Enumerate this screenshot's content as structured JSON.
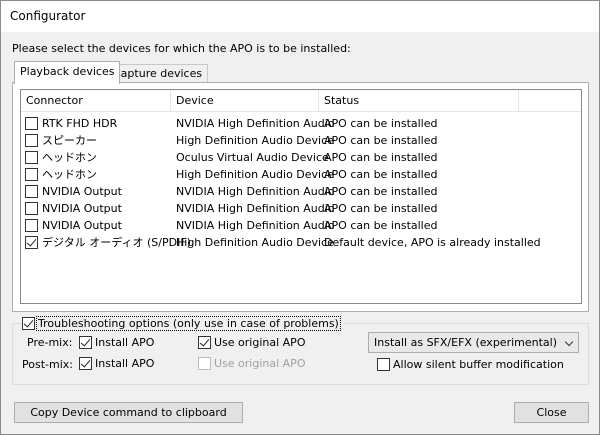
{
  "window": {
    "title": "Configurator"
  },
  "prompt": "Please select the devices for which the APO is to be installed:",
  "tabs": [
    {
      "label": "Playback devices",
      "active": true
    },
    {
      "label": "Capture devices",
      "active": false
    }
  ],
  "list": {
    "columns": [
      "Connector",
      "Device",
      "Status"
    ],
    "rows": [
      {
        "checked": false,
        "connector": "RTK FHD HDR",
        "device": "NVIDIA High Definition Audio",
        "status": "APO can be installed"
      },
      {
        "checked": false,
        "connector": "スピーカー",
        "device": "High Definition Audio Device",
        "status": "APO can be installed"
      },
      {
        "checked": false,
        "connector": "ヘッドホン",
        "device": "Oculus Virtual Audio Device",
        "status": "APO can be installed"
      },
      {
        "checked": false,
        "connector": "ヘッドホン",
        "device": "High Definition Audio Device",
        "status": "APO can be installed"
      },
      {
        "checked": false,
        "connector": "NVIDIA Output",
        "device": "NVIDIA High Definition Audio",
        "status": "APO can be installed"
      },
      {
        "checked": false,
        "connector": "NVIDIA Output",
        "device": "NVIDIA High Definition Audio",
        "status": "APO can be installed"
      },
      {
        "checked": false,
        "connector": "NVIDIA Output",
        "device": "NVIDIA High Definition Audio",
        "status": "APO can be installed"
      },
      {
        "checked": true,
        "connector": "デジタル オーディオ (S/PDIF)",
        "device": "High Definition Audio Device",
        "status": "Default device, APO is already installed"
      }
    ]
  },
  "troubleshooting": {
    "label": "Troubleshooting options (only use in case of problems)",
    "checked": true,
    "premix_label": "Pre-mix:",
    "postmix_label": "Post-mix:",
    "install_apo_label": "Install APO",
    "use_original_apo_label": "Use original APO",
    "premix_install_checked": true,
    "premix_original_checked": true,
    "postmix_install_checked": true,
    "postmix_original_checked": false,
    "install_mode_selected": "Install as SFX/EFX (experimental)",
    "allow_silent_label": "Allow silent buffer modification",
    "allow_silent_checked": false
  },
  "buttons": {
    "copy_label": "Copy Device command to clipboard",
    "close_label": "Close"
  }
}
